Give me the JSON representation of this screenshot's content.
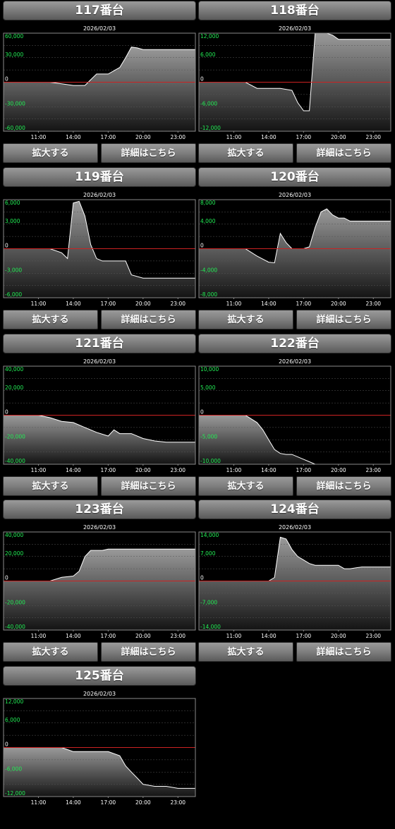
{
  "colors": {
    "axis_label": "#22ee55",
    "zero_line": "#cc2222",
    "background": "#000000",
    "area_top": "#9a9a9a",
    "area_bottom": "#141414",
    "line": "#ffffff"
  },
  "x_ticks": [
    "11:00",
    "14:00",
    "17:00",
    "20:00",
    "23:00"
  ],
  "x_tick_values": [
    11,
    14,
    17,
    20,
    23
  ],
  "x_range": [
    8,
    24.5
  ],
  "panels": [
    {
      "title": "117番台",
      "zoom_label": "拡大する",
      "detail_label": "詳細はこちら"
    },
    {
      "title": "118番台",
      "zoom_label": "拡大する",
      "detail_label": "詳細はこちら"
    },
    {
      "title": "119番台",
      "zoom_label": "拡大する",
      "detail_label": "詳細はこちら"
    },
    {
      "title": "120番台",
      "zoom_label": "拡大する",
      "detail_label": "詳細はこちら"
    },
    {
      "title": "121番台",
      "zoom_label": "拡大する",
      "detail_label": "詳細はこちら"
    },
    {
      "title": "122番台",
      "zoom_label": "拡大する",
      "detail_label": "詳細はこちら"
    },
    {
      "title": "123番台",
      "zoom_label": "拡大する",
      "detail_label": "詳細はこちら"
    },
    {
      "title": "124番台",
      "zoom_label": "拡大する",
      "detail_label": "詳細はこちら"
    },
    {
      "title": "125番台",
      "zoom_label": "拡大する",
      "detail_label": "詳細はこちら"
    }
  ],
  "chart_data": [
    {
      "type": "area",
      "title": "2026/02/03",
      "ylim": [
        -60000,
        60000
      ],
      "y_ticks": [
        "60,000",
        "30,000",
        "0",
        "-30,000",
        "-60,000"
      ],
      "y_tick_values": [
        60000,
        30000,
        0,
        -30000,
        -60000
      ],
      "x": [
        8,
        12,
        13,
        14,
        15,
        16,
        17,
        18,
        18.5,
        19,
        19.5,
        20,
        21,
        22,
        23,
        24,
        24.5
      ],
      "y": [
        0,
        0,
        -2000,
        -4000,
        -4000,
        10000,
        10000,
        18000,
        30000,
        43000,
        42000,
        40000,
        40000,
        40000,
        40000,
        40000,
        40000
      ]
    },
    {
      "type": "area",
      "title": "2026/02/03",
      "ylim": [
        -12000,
        12000
      ],
      "y_ticks": [
        "12,000",
        "6,000",
        "0",
        "-6,000",
        "-12,000"
      ],
      "y_tick_values": [
        12000,
        6000,
        0,
        -6000,
        -12000
      ],
      "x": [
        8,
        12,
        13,
        14,
        15,
        16,
        16.5,
        17,
        17.5,
        18,
        18.5,
        19,
        19.5,
        20,
        21,
        22,
        23,
        24,
        24.5
      ],
      "y": [
        0,
        0,
        -1500,
        -1500,
        -1500,
        -2000,
        -5000,
        -7000,
        -7000,
        12000,
        12000,
        12000,
        11500,
        10500,
        10500,
        10500,
        10500,
        10500,
        10500
      ]
    },
    {
      "type": "area",
      "title": "2026/02/03",
      "ylim": [
        -6000,
        6000
      ],
      "y_ticks": [
        "6,000",
        "3,000",
        "0",
        "-3,000",
        "-6,000"
      ],
      "y_tick_values": [
        6000,
        3000,
        0,
        -3000,
        -6000
      ],
      "x": [
        8,
        12,
        13,
        13.5,
        14,
        14.5,
        15,
        15.5,
        16,
        16.5,
        17,
        17.5,
        18,
        18.5,
        19,
        20,
        21,
        22,
        23,
        24,
        24.5
      ],
      "y": [
        0,
        0,
        -500,
        -1200,
        5600,
        5800,
        4000,
        500,
        -1200,
        -1500,
        -1500,
        -1500,
        -1500,
        -1500,
        -3200,
        -3600,
        -3600,
        -3600,
        -3600,
        -3600,
        -3600
      ]
    },
    {
      "type": "area",
      "title": "2026/02/03",
      "ylim": [
        -8000,
        8000
      ],
      "y_ticks": [
        "8,000",
        "4,000",
        "0",
        "-4,000",
        "-8,000"
      ],
      "y_tick_values": [
        8000,
        4000,
        0,
        -4000,
        -8000
      ],
      "x": [
        8,
        12,
        13,
        14,
        14.5,
        15,
        15.5,
        16,
        16.5,
        17,
        17.5,
        18,
        18.5,
        19,
        19.5,
        20,
        20.5,
        21,
        22,
        23,
        24,
        24.5
      ],
      "y": [
        0,
        0,
        -1200,
        -2200,
        -2300,
        2500,
        1000,
        0,
        0,
        0,
        300,
        3500,
        6000,
        6500,
        5500,
        5000,
        5000,
        4500,
        4500,
        4500,
        4500,
        4500
      ]
    },
    {
      "type": "area",
      "title": "2026/02/03",
      "ylim": [
        -40000,
        40000
      ],
      "y_ticks": [
        "40,000",
        "20,000",
        "0",
        "-20,000",
        "-40,000"
      ],
      "y_tick_values": [
        40000,
        20000,
        0,
        -20000,
        -40000
      ],
      "x": [
        8,
        11,
        12,
        13,
        14,
        15,
        16,
        17,
        17.5,
        18,
        19,
        20,
        21,
        22,
        23,
        24,
        24.5
      ],
      "y": [
        0,
        0,
        -2000,
        -5000,
        -6000,
        -10000,
        -14000,
        -17000,
        -12000,
        -15000,
        -15000,
        -19000,
        -21000,
        -22000,
        -22000,
        -22000,
        -22000
      ]
    },
    {
      "type": "area",
      "title": "2026/02/03",
      "ylim": [
        -10000,
        10000
      ],
      "y_ticks": [
        "10,000",
        "5,000",
        "0",
        "-5,000",
        "-10,000"
      ],
      "y_tick_values": [
        10000,
        5000,
        0,
        -5000,
        -10000
      ],
      "x": [
        8,
        12,
        13,
        13.5,
        14,
        14.5,
        15,
        15.5,
        16,
        17,
        17.5,
        18,
        19,
        20,
        21,
        22,
        23,
        24,
        24.5
      ],
      "y": [
        0,
        0,
        -1500,
        -3000,
        -5000,
        -7000,
        -7800,
        -8000,
        -8000,
        -9000,
        -9500,
        -10000,
        -10000,
        -10000,
        -10000,
        -10000,
        -10000,
        -10000,
        -10000
      ]
    },
    {
      "type": "area",
      "title": "2026/02/03",
      "ylim": [
        -40000,
        40000
      ],
      "y_ticks": [
        "40,000",
        "20,000",
        "0",
        "-20,000",
        "-40,000"
      ],
      "y_tick_values": [
        40000,
        20000,
        0,
        -20000,
        -40000
      ],
      "x": [
        8,
        12,
        13,
        13.5,
        14,
        14.5,
        15,
        15.5,
        16,
        16.5,
        17,
        18,
        19,
        20,
        21,
        22,
        23,
        24,
        24.5
      ],
      "y": [
        0,
        0,
        3000,
        3500,
        4000,
        8000,
        20000,
        25000,
        25000,
        25000,
        26000,
        26000,
        26000,
        26000,
        26000,
        26000,
        26000,
        26000,
        26000
      ]
    },
    {
      "type": "area",
      "title": "2026/02/03",
      "ylim": [
        -14000,
        14000
      ],
      "y_ticks": [
        "14,000",
        "7,000",
        "0",
        "-7,000",
        "-14,000"
      ],
      "y_tick_values": [
        14000,
        7000,
        0,
        -7000,
        -14000
      ],
      "x": [
        8,
        13,
        14,
        14.5,
        15,
        15.5,
        16,
        16.5,
        17,
        17.5,
        18,
        19,
        20,
        20.5,
        21,
        22,
        23,
        24,
        24.5
      ],
      "y": [
        0,
        0,
        0,
        1000,
        12500,
        12000,
        9000,
        7000,
        6000,
        5000,
        4500,
        4500,
        4500,
        3500,
        3500,
        4000,
        4000,
        4000,
        4000
      ]
    },
    {
      "type": "area",
      "title": "2026/02/03",
      "ylim": [
        -12000,
        12000
      ],
      "y_ticks": [
        "12,000",
        "6,000",
        "0",
        "-6,000",
        "-12,000"
      ],
      "y_tick_values": [
        12000,
        6000,
        0,
        -6000,
        -12000
      ],
      "x": [
        8,
        12,
        13,
        14,
        15,
        16,
        17,
        18,
        18.5,
        19,
        19.5,
        20,
        21,
        22,
        23,
        24,
        24.5
      ],
      "y": [
        0,
        0,
        0,
        -1000,
        -1000,
        -1000,
        -1000,
        -2000,
        -4500,
        -6000,
        -7500,
        -9000,
        -9500,
        -9500,
        -10000,
        -10000,
        -10000
      ]
    }
  ]
}
